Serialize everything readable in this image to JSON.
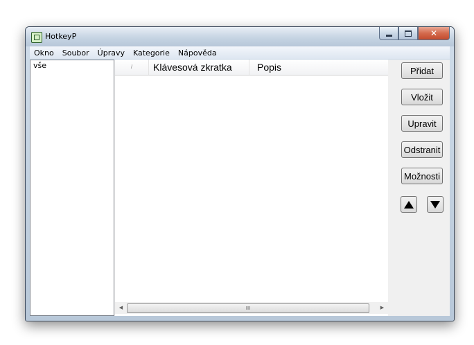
{
  "window": {
    "title": "HotkeyP"
  },
  "menu": {
    "items": [
      "Okno",
      "Soubor",
      "Úpravy",
      "Kategorie",
      "Nápověda"
    ]
  },
  "categories": {
    "items": [
      "vše"
    ]
  },
  "list": {
    "columns": {
      "sort": "/",
      "shortcut": "Klávesová zkratka",
      "description": "Popis"
    },
    "scroll_thumb_grip": "III"
  },
  "buttons": {
    "add": "Přidat",
    "insert": "Vložit",
    "edit": "Upravit",
    "remove": "Odstranit",
    "options": "Možnosti"
  },
  "icons": {
    "app": "hotkeyp-app-icon",
    "minimize": "minimize-icon",
    "maximize": "maximize-icon",
    "close": "close-icon",
    "move_up": "triangle-up-icon",
    "move_down": "triangle-down-icon",
    "scroll_left": "scroll-left-icon",
    "scroll_right": "scroll-right-icon"
  },
  "colors": {
    "close_button": "#c24b2e",
    "titlebar": "#c6d4e3"
  }
}
